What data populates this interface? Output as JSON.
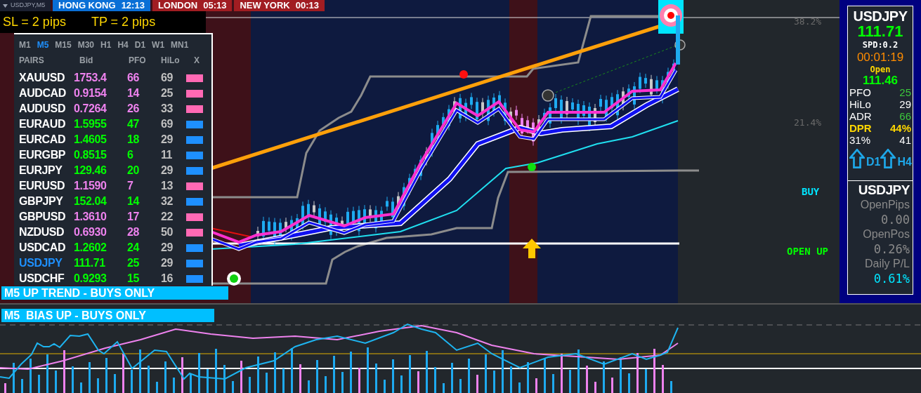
{
  "symbol_tab": {
    "label": "USDJPY,M5"
  },
  "sessions": [
    {
      "city": "HONG KONG",
      "time": "12:13",
      "color": "#0a6fd6"
    },
    {
      "city": "LONDON",
      "time": "05:13",
      "color": "#a11d22"
    },
    {
      "city": "NEW YORK",
      "time": "00:13",
      "color": "#a11d22"
    }
  ],
  "sl_tp": {
    "sl": "SL = 2 pips",
    "tp": "TP = 2 pips"
  },
  "pairs_panel": {
    "timeframes": [
      {
        "label": "M1",
        "selected": false
      },
      {
        "label": "M5",
        "selected": true
      },
      {
        "label": "M15",
        "selected": false
      },
      {
        "label": "M30",
        "selected": false
      },
      {
        "label": "H1",
        "selected": false
      },
      {
        "label": "H4",
        "selected": false
      },
      {
        "label": "D1",
        "selected": false
      },
      {
        "label": "W1",
        "selected": false
      },
      {
        "label": "MN1",
        "selected": false
      }
    ],
    "columns": [
      "PAIRS",
      "Bid",
      "PFO",
      "HiLo",
      "X"
    ],
    "rows": [
      {
        "pair": "XAUUSD",
        "bid": "1753.4",
        "pfo": "66",
        "hilo": "69",
        "color": "#ff69b4",
        "selected": false
      },
      {
        "pair": "AUDCAD",
        "bid": "0.9154",
        "pfo": "14",
        "hilo": "25",
        "color": "#ff69b4",
        "selected": false
      },
      {
        "pair": "AUDUSD",
        "bid": "0.7264",
        "pfo": "26",
        "hilo": "33",
        "color": "#ff69b4",
        "selected": false
      },
      {
        "pair": "EURAUD",
        "bid": "1.5955",
        "pfo": "47",
        "hilo": "69",
        "color": "#1e90ff",
        "selected": false
      },
      {
        "pair": "EURCAD",
        "bid": "1.4605",
        "pfo": "18",
        "hilo": "29",
        "color": "#1e90ff",
        "selected": false
      },
      {
        "pair": "EURGBP",
        "bid": "0.8515",
        "pfo": "6",
        "hilo": "11",
        "color": "#1e90ff",
        "selected": false
      },
      {
        "pair": "EURJPY",
        "bid": "129.46",
        "pfo": "20",
        "hilo": "29",
        "color": "#1e90ff",
        "selected": false
      },
      {
        "pair": "EURUSD",
        "bid": "1.1590",
        "pfo": "7",
        "hilo": "13",
        "color": "#ff69b4",
        "selected": false
      },
      {
        "pair": "GBPJPY",
        "bid": "152.04",
        "pfo": "14",
        "hilo": "32",
        "color": "#1e90ff",
        "selected": false
      },
      {
        "pair": "GBPUSD",
        "bid": "1.3610",
        "pfo": "17",
        "hilo": "22",
        "color": "#ff69b4",
        "selected": false
      },
      {
        "pair": "NZDUSD",
        "bid": "0.6930",
        "pfo": "28",
        "hilo": "50",
        "color": "#ff69b4",
        "selected": false
      },
      {
        "pair": "USDCAD",
        "bid": "1.2602",
        "pfo": "24",
        "hilo": "29",
        "color": "#1e90ff",
        "selected": false
      },
      {
        "pair": "USDJPY",
        "bid": "111.71",
        "pfo": "25",
        "hilo": "29",
        "color": "#1e90ff",
        "selected": true
      },
      {
        "pair": "USDCHF",
        "bid": "0.9293",
        "pfo": "15",
        "hilo": "16",
        "color": "#1e90ff",
        "selected": false
      }
    ]
  },
  "trend_banner": "M5 UP TREND - BUYS ONLY",
  "chart": {
    "levels": [
      {
        "label": "38.2%"
      },
      {
        "label": "21.4%"
      }
    ],
    "signals": [
      {
        "label": "BUY",
        "kind": "buy"
      },
      {
        "label": "OPEN UP",
        "kind": "open"
      }
    ]
  },
  "info_panel": {
    "symbol": "USDJPY",
    "price": "111.71",
    "spread": "SPD:0.2",
    "timer": "00:01:19",
    "open_label": "Open",
    "open_price": "111.46",
    "stats": [
      {
        "label": "PFO",
        "value": "25",
        "kind": "good"
      },
      {
        "label": "HiLo",
        "value": "29",
        "kind": "plain"
      },
      {
        "label": "ADR",
        "value": "66",
        "kind": "good"
      },
      {
        "label": "DPR",
        "value": "44%",
        "kind": "highlight"
      },
      {
        "label": "31%",
        "value": "41",
        "kind": "plain"
      }
    ],
    "arrows": [
      {
        "label": "D1",
        "kind": "up"
      },
      {
        "label": "H4",
        "kind": "up"
      }
    ]
  },
  "position_panel": {
    "symbol": "USDJPY",
    "items": [
      {
        "label": "OpenPips",
        "value": "0.00",
        "kind": "plain"
      },
      {
        "label": "OpenPos",
        "value": "0.26%",
        "kind": "plain"
      },
      {
        "label": "Daily P/L",
        "value": "0.61%",
        "kind": "positive"
      }
    ]
  },
  "bias_banner": "M5  BIAS UP - BUYS ONLY"
}
